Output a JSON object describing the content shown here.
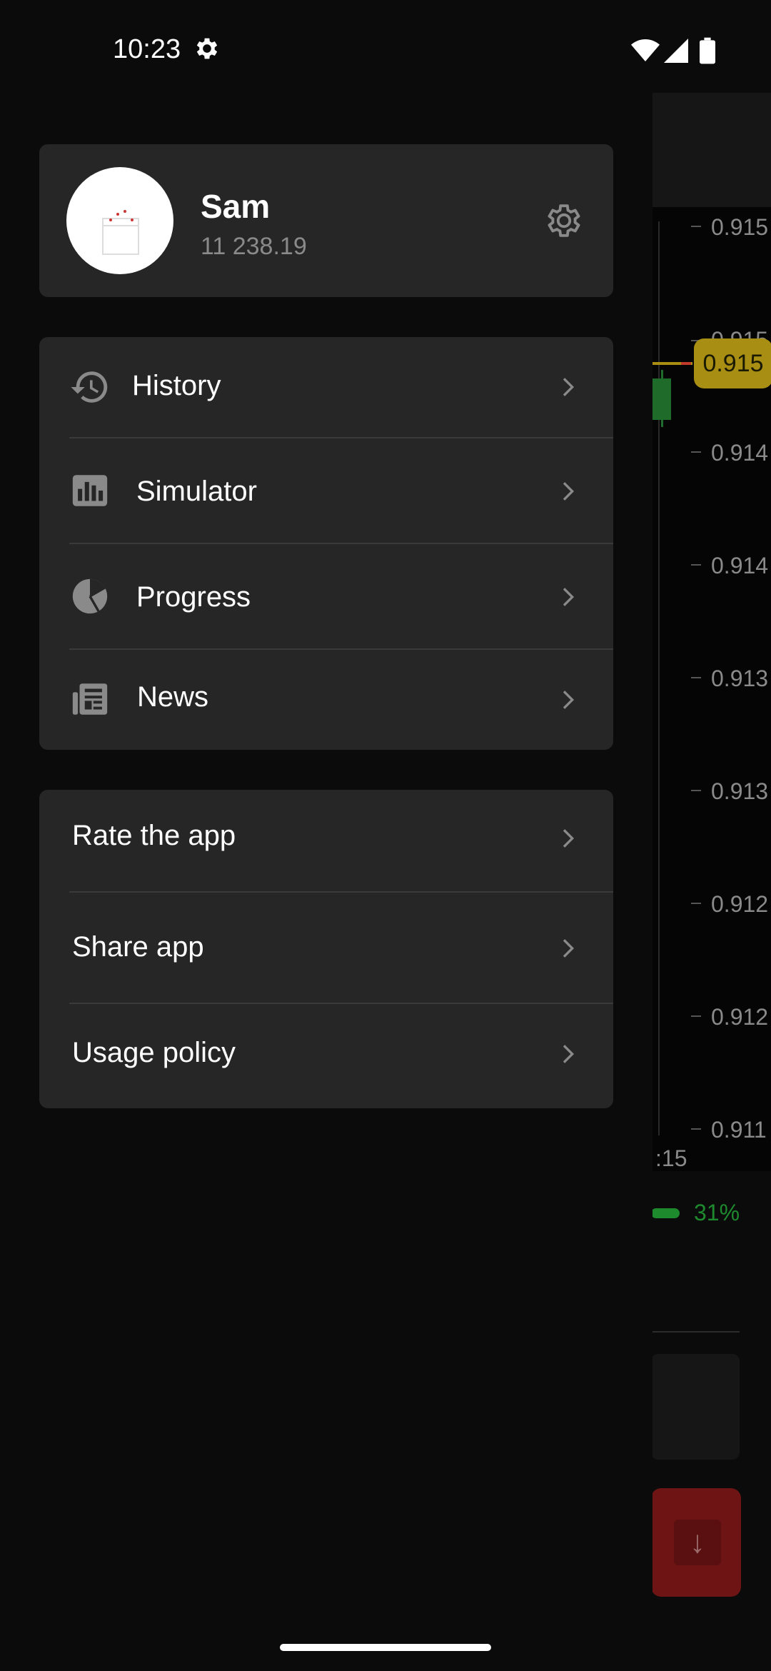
{
  "status_bar": {
    "time": "10:23"
  },
  "background": {
    "price_ticks": [
      "0.915",
      "0.915",
      "0.914",
      "0.914",
      "0.913",
      "0.913",
      "0.912",
      "0.912",
      "0.911"
    ],
    "current_price": "0.915",
    "time_label": ":15",
    "percent": "31%",
    "colors": {
      "up": "#1e8a2e",
      "price_badge": "#a88f14",
      "sell": "#6e1414"
    }
  },
  "profile": {
    "name": "Sam",
    "balance": "11 238.19"
  },
  "menu_primary": [
    {
      "label": "History",
      "icon": "history-icon"
    },
    {
      "label": "Simulator",
      "icon": "bar-chart-icon"
    },
    {
      "label": "Progress",
      "icon": "pie-chart-icon"
    },
    {
      "label": "News",
      "icon": "newspaper-icon"
    }
  ],
  "menu_secondary": [
    {
      "label": "Rate the app"
    },
    {
      "label": "Share app"
    },
    {
      "label": "Usage policy"
    }
  ]
}
